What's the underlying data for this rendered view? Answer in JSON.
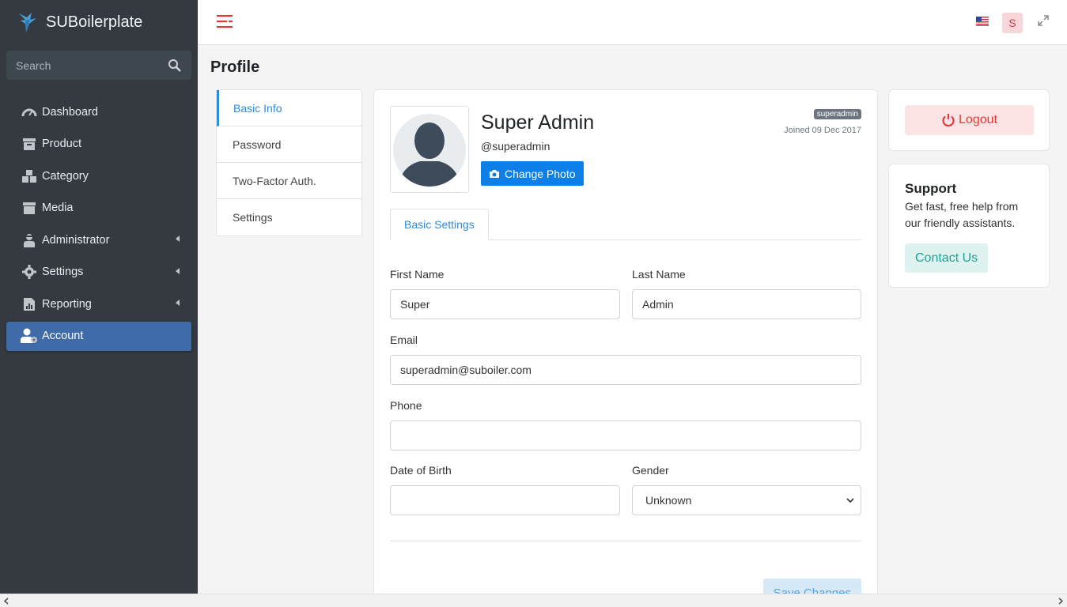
{
  "brand": {
    "name": "SUBoilerplate"
  },
  "search": {
    "placeholder": "Search"
  },
  "sidebar": {
    "items": [
      {
        "label": "Dashboard",
        "icon": "dashboard-icon"
      },
      {
        "label": "Product",
        "icon": "product-icon"
      },
      {
        "label": "Category",
        "icon": "category-icon"
      },
      {
        "label": "Media",
        "icon": "media-icon"
      },
      {
        "label": "Administrator",
        "icon": "administrator-icon",
        "expandable": true
      },
      {
        "label": "Settings",
        "icon": "settings-icon",
        "expandable": true
      },
      {
        "label": "Reporting",
        "icon": "reporting-icon",
        "expandable": true
      },
      {
        "label": "Account",
        "icon": "account-icon",
        "active": true
      }
    ]
  },
  "topbar": {
    "user_initial": "S"
  },
  "page": {
    "title": "Profile"
  },
  "profile_menu": {
    "items": [
      {
        "label": "Basic Info",
        "active": true
      },
      {
        "label": "Password"
      },
      {
        "label": "Two-Factor Auth."
      },
      {
        "label": "Settings"
      }
    ]
  },
  "user": {
    "name": "Super Admin",
    "handle": "@superadmin",
    "role": "superadmin",
    "joined": "Joined 09 Dec 2017",
    "change_photo_label": "Change Photo"
  },
  "tabs": {
    "basic_settings": "Basic Settings"
  },
  "form": {
    "first_name_label": "First Name",
    "first_name_value": "Super",
    "last_name_label": "Last Name",
    "last_name_value": "Admin",
    "email_label": "Email",
    "email_value": "superadmin@suboiler.com",
    "phone_label": "Phone",
    "phone_value": "",
    "dob_label": "Date of Birth",
    "dob_value": "",
    "gender_label": "Gender",
    "gender_value": "Unknown",
    "save_label": "Save Changes"
  },
  "logout": {
    "label": "Logout"
  },
  "support": {
    "title": "Support",
    "text": "Get fast, free help from our friendly assistants.",
    "contact_label": "Contact Us"
  },
  "colors": {
    "sidebar_bg": "#343a40",
    "active_nav": "#3f6ca8",
    "primary": "#0d7fe6",
    "danger": "#e03a3a",
    "teal": "#20a090"
  }
}
